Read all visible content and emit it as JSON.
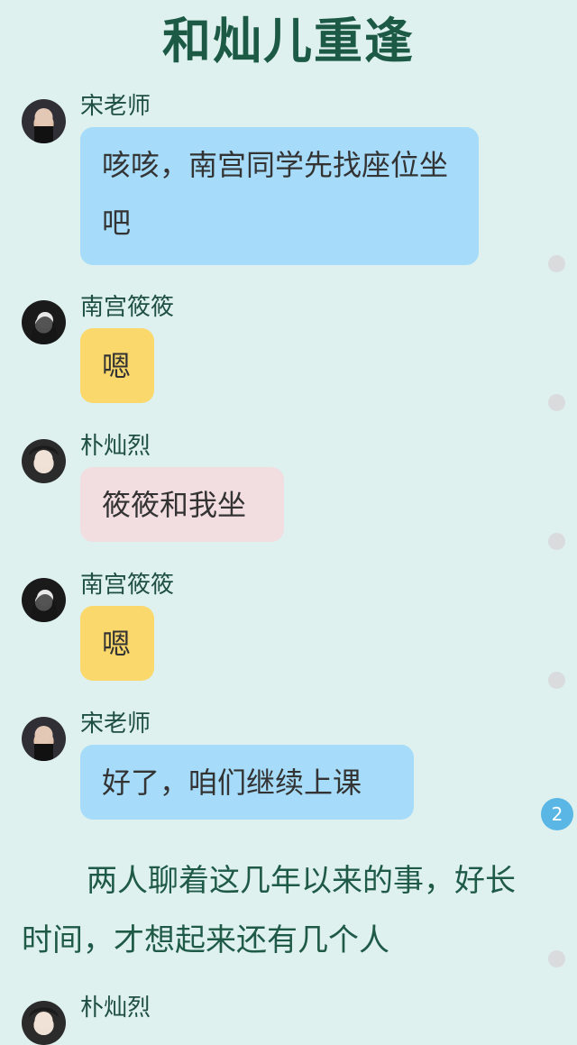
{
  "title": "和灿儿重逢",
  "messages": [
    {
      "speaker": "宋老师",
      "text": "咳咳，南宫同学先找座位坐吧",
      "bubble_color": "#a6dcf9",
      "avatar": "teacher-avatar"
    },
    {
      "speaker": "南宫筱筱",
      "text": "嗯",
      "bubble_color": "#fbd86c",
      "avatar": "girl-avatar"
    },
    {
      "speaker": "朴灿烈",
      "text": "筱筱和我坐",
      "bubble_color": "#f2dde1",
      "avatar": "boy-avatar"
    },
    {
      "speaker": "南宫筱筱",
      "text": "嗯",
      "bubble_color": "#fbd86c",
      "avatar": "girl-avatar"
    },
    {
      "speaker": "宋老师",
      "text": "好了，咱们继续上课",
      "bubble_color": "#a6dcf9",
      "avatar": "teacher-avatar"
    },
    {
      "speaker": "朴灿烈",
      "text": "",
      "bubble_color": "",
      "avatar": "boy-avatar"
    }
  ],
  "comment_badge": "2",
  "narration": "两人聊着这几年以来的事，好长时间，才想起来还有几个人"
}
